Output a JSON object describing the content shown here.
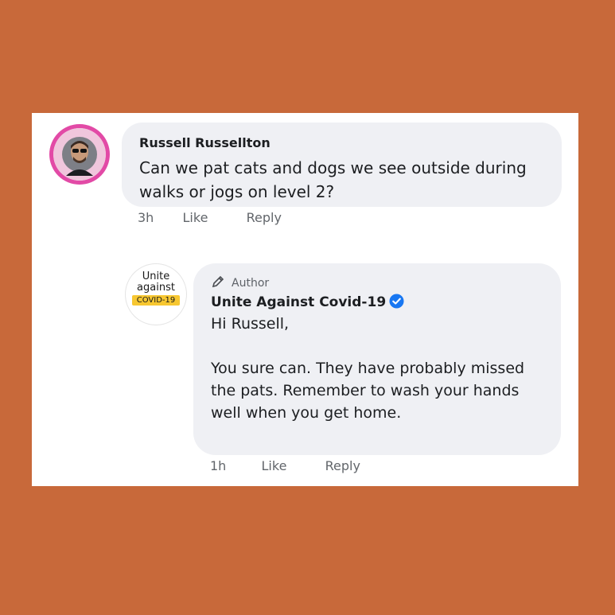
{
  "comments": [
    {
      "author": "Russell Russellton",
      "text": "Can we pat cats and dogs we see outside during walks or jogs on level 2?",
      "time": "3h",
      "like_label": "Like",
      "reply_label": "Reply",
      "avatar_icon": "profile-photo-icon"
    },
    {
      "author_badge": "Author",
      "author": "Unite Against Covid-19",
      "verified": true,
      "greeting": "Hi Russell,",
      "text": "You sure can. They have probably missed the pats. Remember to wash your hands well when you get home.",
      "time": "1h",
      "like_label": "Like",
      "reply_label": "Reply",
      "avatar_logo": {
        "line1": "Unite",
        "line2": "against",
        "line3": "COVID-19"
      }
    }
  ],
  "colors": {
    "background": "#c8693a",
    "bubble": "#eff0f4",
    "verified": "#1877f2",
    "logo_highlight": "#f7c731",
    "avatar_ring": "#e24aa6"
  }
}
